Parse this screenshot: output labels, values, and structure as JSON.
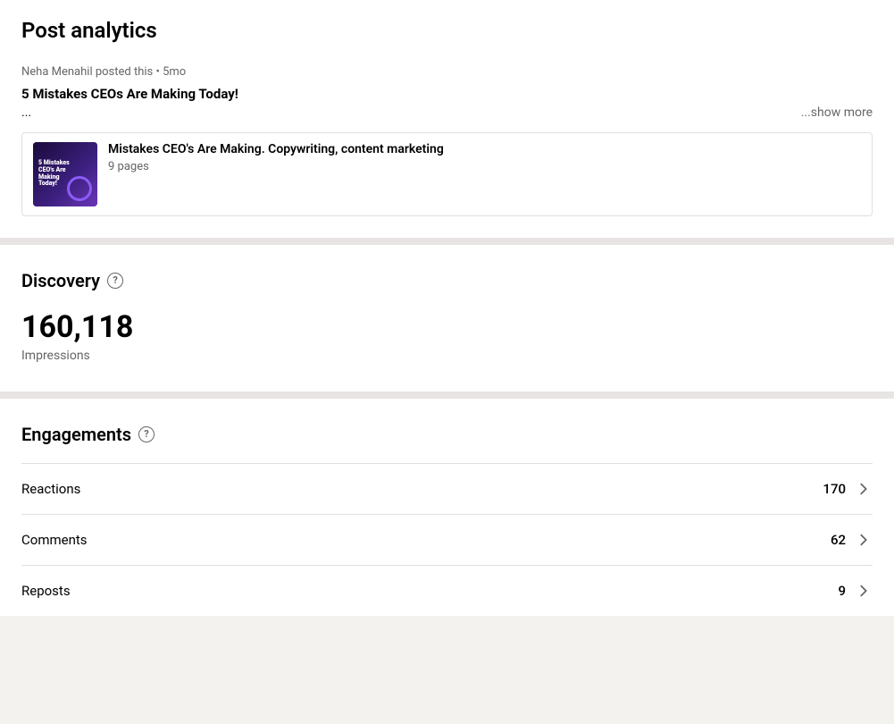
{
  "page": {
    "title": "Post analytics"
  },
  "post": {
    "meta": "Neha Menahil posted this • 5mo",
    "title": "5 Mistakes CEOs Are Making Today!",
    "preview_text": "...",
    "show_more_label": "...show more",
    "card": {
      "thumbnail_alt": "5 Mistakes CEOs Are Making Today! book cover",
      "title": "Mistakes CEO's Are Making. Copywriting, content marketing",
      "subtitle": "9 pages"
    }
  },
  "discovery": {
    "title": "Discovery",
    "help_label": "?",
    "impressions_number": "160,118",
    "impressions_label": "Impressions"
  },
  "engagements": {
    "title": "Engagements",
    "help_label": "?",
    "rows": [
      {
        "label": "Reactions",
        "count": "170"
      },
      {
        "label": "Comments",
        "count": "62"
      },
      {
        "label": "Reposts",
        "count": "9"
      }
    ]
  }
}
